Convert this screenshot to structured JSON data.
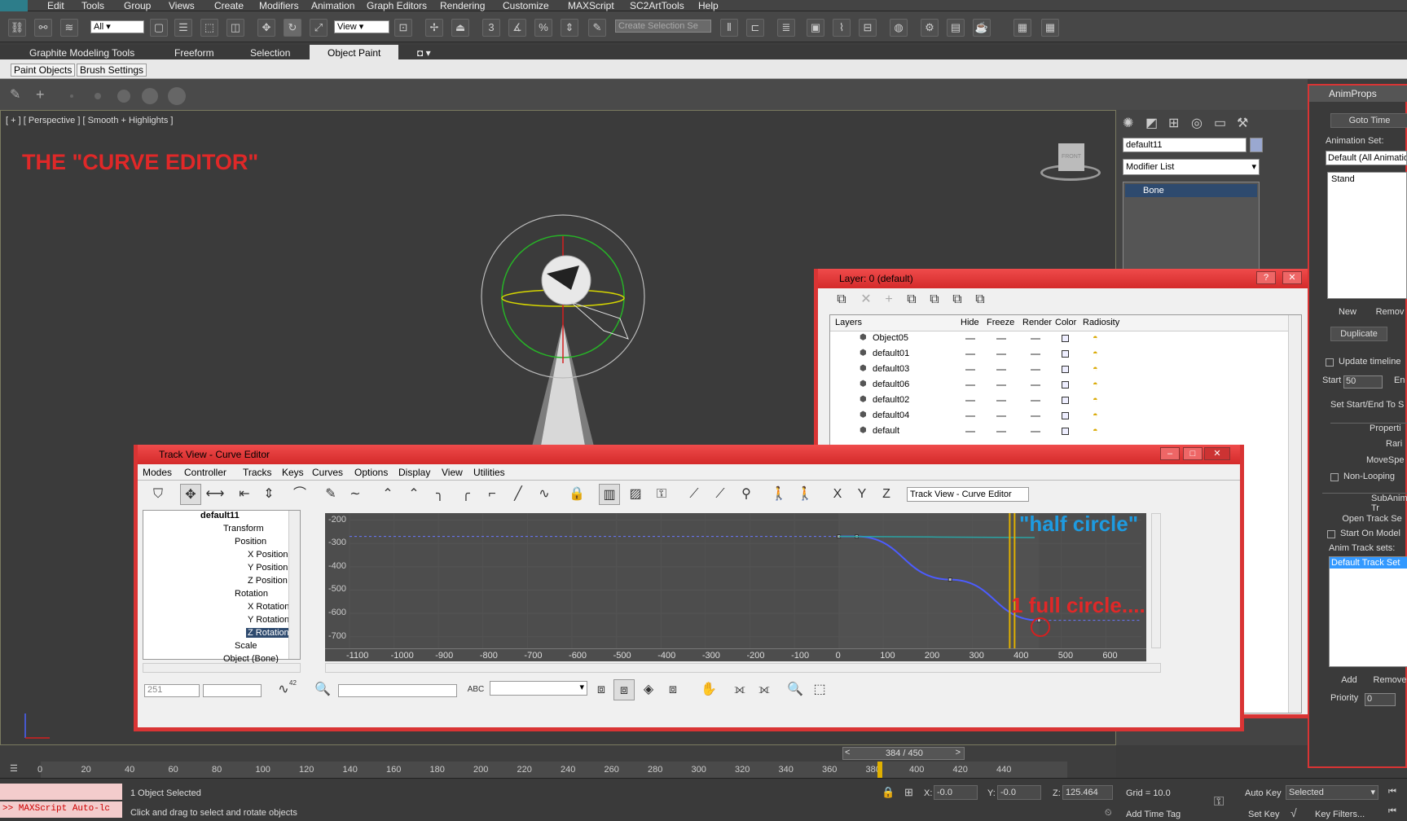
{
  "menu": [
    "Edit",
    "Tools",
    "Group",
    "Views",
    "Create",
    "Modifiers",
    "Animation",
    "Graph Editors",
    "Rendering",
    "Customize",
    "MAXScript",
    "SC2ArtTools",
    "Help"
  ],
  "toolbar": {
    "filter_value": "All",
    "refcoord_value": "View",
    "selection_set_placeholder": "Create Selection Se"
  },
  "ribbon": {
    "tabs": [
      "Graphite Modeling Tools",
      "Freeform",
      "Selection",
      "Object Paint"
    ],
    "active_tab": "Object Paint",
    "subtabs": [
      "Paint Objects",
      "Brush Settings"
    ]
  },
  "viewport": {
    "label": "[ + ] [ Perspective ] [ Smooth + Highlights ]",
    "annotation": "THE \"CURVE EDITOR\"",
    "viewcube_label": "FRONT"
  },
  "command_panel": {
    "object_name": "default11",
    "modifier_list": "Modifier List",
    "stack_item": "Bone"
  },
  "layer_dialog": {
    "title": "Layer: 0 (default)",
    "columns": [
      "Layers",
      "Hide",
      "Freeze",
      "Render",
      "Color",
      "Radiosity"
    ],
    "rows": [
      "Object05",
      "default01",
      "default03",
      "default06",
      "default02",
      "default04",
      "default"
    ]
  },
  "curve_editor": {
    "title": "Track View - Curve Editor",
    "menu": [
      "Modes",
      "Controller",
      "Tracks",
      "Keys",
      "Curves",
      "Options",
      "Display",
      "View",
      "Utilities"
    ],
    "name_field": "Track View - Curve Editor",
    "tree": [
      {
        "label": "default11",
        "level": 0
      },
      {
        "label": "Transform",
        "level": 1
      },
      {
        "label": "Position",
        "level": 2
      },
      {
        "label": "X Position",
        "level": 3
      },
      {
        "label": "Y Position",
        "level": 3
      },
      {
        "label": "Z Position",
        "level": 3
      },
      {
        "label": "Rotation",
        "level": 2
      },
      {
        "label": "X Rotation",
        "level": 3
      },
      {
        "label": "Y Rotation",
        "level": 3
      },
      {
        "label": "Z Rotation",
        "level": 3
      },
      {
        "label": "Scale",
        "level": 2
      },
      {
        "label": "Object (Bone)",
        "level": 1
      }
    ],
    "selected_track": "Z Rotation",
    "y_ticks": [
      "-200",
      "-300",
      "-400",
      "-500",
      "-600",
      "-700"
    ],
    "x_ticks": [
      "-1100",
      "-1000",
      "-900",
      "-800",
      "-700",
      "-600",
      "-500",
      "-400",
      "-300",
      "-200",
      "-100",
      "0",
      "100",
      "200",
      "300",
      "400",
      "500",
      "600"
    ],
    "annotation_blue": "\"half circle\"",
    "annotation_red": "1 full circle....",
    "frame_field": "251",
    "zoom_value": "42"
  },
  "anim_props": {
    "title": "AnimProps",
    "goto_time": "Goto Time",
    "animation_set_label": "Animation Set:",
    "animation_set_value": "Default (All Animatio",
    "list_item": "Stand",
    "new": "New",
    "remove": "Remov",
    "duplicate": "Duplicate",
    "update_timeline": "Update timeline",
    "start_label": "Start",
    "start_value": "50",
    "end_label": "En",
    "set_start_end": "Set Start/End To S",
    "properties": "Properti",
    "rarity": "Rari",
    "movespeed": "MoveSpe",
    "non_looping": "Non-Looping",
    "subanim": "SubAnim Tr",
    "open_track": "Open Track Se",
    "start_on_model": "Start On Model",
    "anim_track_sets": "Anim Track sets:",
    "default_track_set": "Default Track Set",
    "add": "Add",
    "remove2": "Remove",
    "priority_label": "Priority",
    "priority_value": "0"
  },
  "timeline": {
    "slider": "384 / 450",
    "ticks": [
      "0",
      "20",
      "40",
      "60",
      "80",
      "100",
      "120",
      "140",
      "160",
      "180",
      "200",
      "220",
      "240",
      "260",
      "280",
      "300",
      "320",
      "340",
      "360",
      "380",
      "400",
      "420",
      "440"
    ]
  },
  "status": {
    "maxscript": ">> MAXScript Auto-lc",
    "selected": "1 Object Selected",
    "prompt": "Click and drag to select and rotate objects",
    "x_label": "X:",
    "x_value": "-0.0",
    "y_label": "Y:",
    "y_value": "-0.0",
    "z_label": "Z:",
    "z_value": "125.464",
    "grid": "Grid = 10.0",
    "add_time_tag": "Add Time Tag",
    "auto_key": "Auto Key",
    "selected_value": "Selected",
    "set_key": "Set Key",
    "key_filters": "Key Filters..."
  },
  "chart_data": {
    "type": "line",
    "xlabel": "",
    "ylabel": "",
    "xlim": [
      -1100,
      680
    ],
    "ylim": [
      -750,
      -170
    ],
    "series": [
      {
        "key": "z_rotation_curve",
        "color": "#4c5cff",
        "x": [
          0,
          40,
          250,
          450
        ],
        "y": [
          -270,
          -270,
          -455,
          -630
        ]
      },
      {
        "key": "teal_curve",
        "color": "#2aa3a3",
        "x": [
          0,
          440
        ],
        "y": [
          -270,
          -275
        ]
      }
    ],
    "annotations": [
      "\"half circle\"",
      "1 full circle...."
    ]
  }
}
